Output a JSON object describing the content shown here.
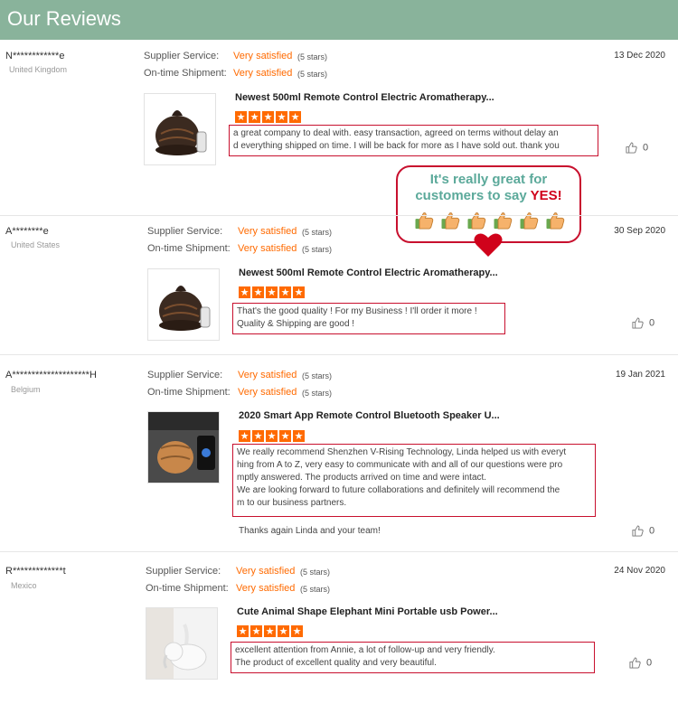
{
  "header": {
    "title": "Our Reviews"
  },
  "labels": {
    "supplier_service": "Supplier Service:",
    "ontime_shipment": "On-time Shipment:"
  },
  "reviews": [
    {
      "buyer": "N************e",
      "country": "United Kingdom",
      "date": "13 Dec 2020",
      "supplier_rating": "Very satisfied",
      "supplier_stars": "(5 stars)",
      "shipment_rating": "Very satisfied",
      "shipment_stars": "(5 stars)",
      "product_title": "Newest 500ml Remote Control Electric Aromatherapy...",
      "stars": 5,
      "text_lines": [
        "a great company to deal with. easy transaction, agreed on terms without delay an",
        "d everything shipped on time. I will be back for more as I have sold out. thank you"
      ],
      "likes": "0"
    },
    {
      "buyer": "A********e",
      "country": "United States",
      "date": "30 Sep 2020",
      "supplier_rating": "Very satisfied",
      "supplier_stars": "(5 stars)",
      "shipment_rating": "Very satisfied",
      "shipment_stars": "(5 stars)",
      "product_title": "Newest 500ml Remote Control Electric Aromatherapy...",
      "stars": 5,
      "text_lines": [
        "That's the good quality ! For my Business ! I'll order it more !",
        "Quality & Shipping are good !"
      ],
      "likes": "0"
    },
    {
      "buyer": "A********************H",
      "country": "Belgium",
      "date": "19 Jan 2021",
      "supplier_rating": "Very satisfied",
      "supplier_stars": "(5 stars)",
      "shipment_rating": "Very satisfied",
      "shipment_stars": "(5 stars)",
      "product_title": "2020 Smart App Remote Control Bluetooth Speaker U...",
      "stars": 5,
      "text_lines": [
        "We really recommend Shenzhen V-Rising Technology, Linda helped us with everyt",
        "hing from A to Z, very easy to communicate with and all of our questions were pro",
        "mptly answered. The products arrived on time and were intact.",
        "We are looking forward to future collaborations and definitely will recommend the",
        "m to our business partners."
      ],
      "extra_text": "Thanks again Linda and your team!",
      "likes": "0"
    },
    {
      "buyer": "R*************t",
      "country": "Mexico",
      "date": "24 Nov 2020",
      "supplier_rating": "Very satisfied",
      "supplier_stars": "(5 stars)",
      "shipment_rating": "Very satisfied",
      "shipment_stars": "(5 stars)",
      "product_title": "Cute Animal Shape Elephant Mini Portable usb Power...",
      "stars": 5,
      "text_lines": [
        "excellent attention from Annie, a lot of follow-up and very friendly.",
        "The product of excellent quality and very beautiful."
      ],
      "likes": "0"
    }
  ],
  "callout": {
    "line1": "It's really great for",
    "line2_prefix": "customers to say",
    "line2_emphasis": "YES!",
    "thumbs_count": 6
  },
  "colors": {
    "header_bg": "#89b39b",
    "rating_orange": "#ff6a00",
    "callout_border": "#c8102e",
    "callout_text": "#5ba99a",
    "callout_yes": "#d0021b"
  },
  "icons": {
    "like": "thumbs-up-icon",
    "callout_thumb": "thumbs-up-icon",
    "heart": "heart-icon",
    "star": "star-icon"
  }
}
